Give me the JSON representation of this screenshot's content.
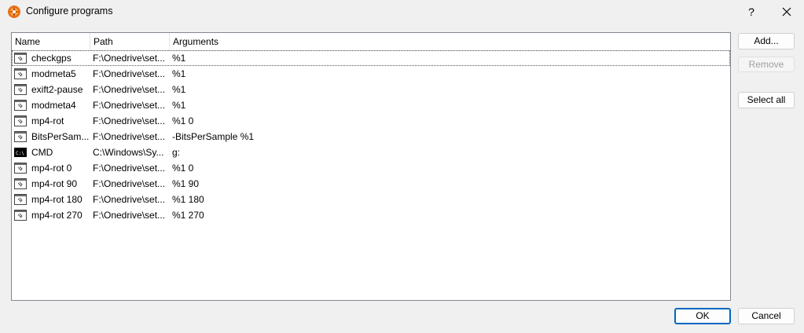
{
  "window": {
    "title": "Configure programs",
    "help_label": "?",
    "close_label": "✕"
  },
  "list": {
    "columns": [
      "Name",
      "Path",
      "Arguments"
    ],
    "rows": [
      {
        "name": "checkgps",
        "path": "F:\\Onedrive\\set...",
        "args": "%1",
        "icon": "program-icon"
      },
      {
        "name": "modmeta5",
        "path": "F:\\Onedrive\\set...",
        "args": "%1",
        "icon": "program-icon"
      },
      {
        "name": "exift2-pause",
        "path": "F:\\Onedrive\\set...",
        "args": "%1",
        "icon": "program-icon"
      },
      {
        "name": "modmeta4",
        "path": "F:\\Onedrive\\set...",
        "args": "%1",
        "icon": "program-icon"
      },
      {
        "name": "mp4-rot",
        "path": "F:\\Onedrive\\set...",
        "args": "%1 0",
        "icon": "program-icon"
      },
      {
        "name": "BitsPerSam...",
        "path": "F:\\Onedrive\\set...",
        "args": "-BitsPerSample %1",
        "icon": "program-icon"
      },
      {
        "name": "CMD",
        "path": "C:\\Windows\\Sy...",
        "args": "g:",
        "icon": "console-icon"
      },
      {
        "name": "mp4-rot 0",
        "path": "F:\\Onedrive\\set...",
        "args": "%1 0",
        "icon": "program-icon"
      },
      {
        "name": "mp4-rot 90",
        "path": "F:\\Onedrive\\set...",
        "args": "%1 90",
        "icon": "program-icon"
      },
      {
        "name": "mp4-rot 180",
        "path": "F:\\Onedrive\\set...",
        "args": "%1 180",
        "icon": "program-icon"
      },
      {
        "name": "mp4-rot 270",
        "path": "F:\\Onedrive\\set...",
        "args": "%1 270",
        "icon": "program-icon"
      }
    ]
  },
  "buttons": {
    "add": "Add...",
    "remove": "Remove",
    "select_all": "Select all",
    "ok": "OK",
    "cancel": "Cancel"
  },
  "colors": {
    "accent": "#0067c0",
    "disabled_text": "#a0a0a0"
  }
}
